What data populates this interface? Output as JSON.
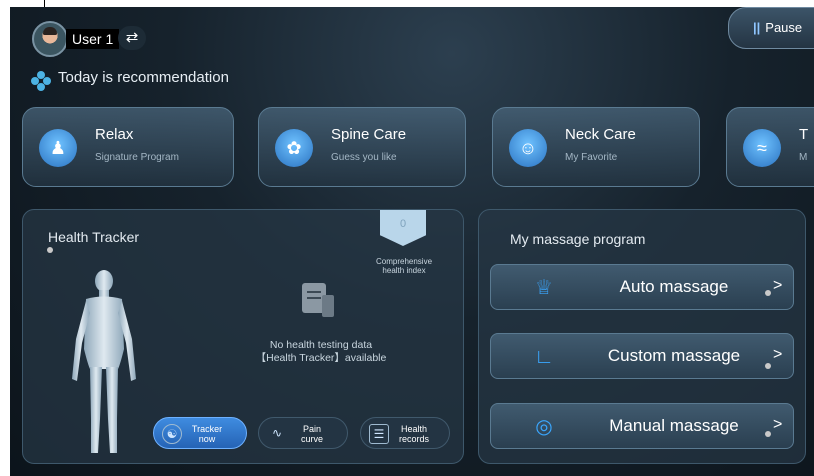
{
  "header": {
    "user_name": "User 1",
    "switch_icon": "⇄",
    "pause_label": "Pause",
    "pause_icon": "pause-icon"
  },
  "recommendation": {
    "title": "Today is recommendation",
    "cards": [
      {
        "title": "Relax",
        "subtitle": "Signature Program",
        "icon": "meditation-icon"
      },
      {
        "title": "Spine Care",
        "subtitle": "Guess you like",
        "icon": "spine-care-icon"
      },
      {
        "title": "Neck Care",
        "subtitle": "My Favorite",
        "icon": "neck-care-icon"
      },
      {
        "title": "T",
        "subtitle": "M",
        "icon": "massage-chair-icon"
      }
    ]
  },
  "health_tracker": {
    "title": "Health Tracker",
    "index_value": "0",
    "index_label": "Comprehensive health index",
    "no_data_line1": "No health testing data",
    "no_data_line2": "【Health Tracker】available",
    "buttons": [
      {
        "label": "Tracker now",
        "icon": "tracker-icon",
        "active": true
      },
      {
        "label": "Pain curve",
        "icon": "curve-icon",
        "active": false
      },
      {
        "label": "Health records",
        "icon": "records-icon",
        "active": false
      }
    ]
  },
  "massage_program": {
    "title": "My massage program",
    "buttons": [
      {
        "label": "Auto massage",
        "icon": "crown-icon"
      },
      {
        "label": "Custom massage",
        "icon": "recline-icon"
      },
      {
        "label": "Manual massage",
        "icon": "target-icon"
      }
    ],
    "chevron": ">"
  },
  "colors": {
    "accent_blue": "#3aa7ff",
    "background": "#16222c"
  }
}
